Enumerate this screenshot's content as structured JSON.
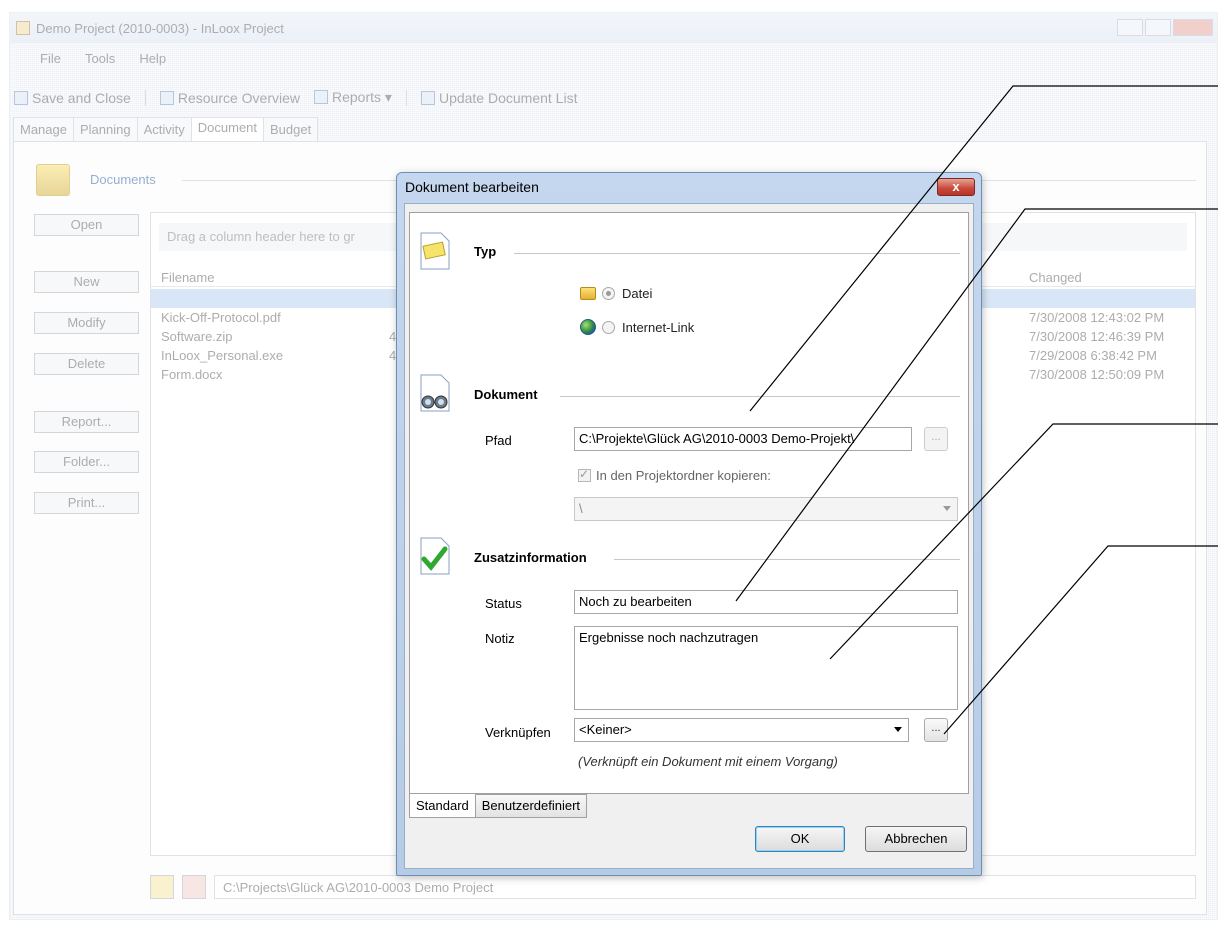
{
  "main_window": {
    "title": "Demo Project (2010-0003) - InLoox Project",
    "menu": [
      "File",
      "Tools",
      "Help"
    ],
    "toolbar": {
      "save_close": "Save and Close",
      "resource_overview": "Resource Overview",
      "reports": "Reports",
      "update_list": "Update Document List"
    },
    "tabs": [
      "Manage",
      "Planning",
      "Activity",
      "Document",
      "Budget"
    ],
    "active_tab": "Document",
    "documents_title": "Documents",
    "side_buttons": [
      "Open",
      "New",
      "Modify",
      "Delete",
      "Report...",
      "Folder...",
      "Print..."
    ],
    "grid": {
      "group_hint": "Drag a column header here to gr",
      "columns": [
        "Filename",
        "Changed"
      ],
      "rows": [
        {
          "filename": "",
          "size": "",
          "changed": ""
        },
        {
          "filename": "Kick-Off-Protocol.pdf",
          "size": "",
          "changed": "7/30/2008 12:43:02 PM"
        },
        {
          "filename": "Software.zip",
          "size": "4",
          "changed": "7/30/2008 12:46:39 PM"
        },
        {
          "filename": "InLoox_Personal.exe",
          "size": "4",
          "changed": "7/29/2008 6:38:42 PM"
        },
        {
          "filename": "Form.docx",
          "size": "",
          "changed": "7/30/2008 12:50:09 PM"
        }
      ]
    },
    "footer_path": "C:\\Projects\\Glück AG\\2010-0003 Demo Project"
  },
  "dialog": {
    "title": "Dokument bearbeiten",
    "close_glyph": "x",
    "typ": {
      "heading": "Typ",
      "options": [
        {
          "label": "Datei",
          "checked": true,
          "icon": "folder-icon"
        },
        {
          "label": "Internet-Link",
          "checked": false,
          "icon": "globe-icon"
        }
      ]
    },
    "dokument": {
      "heading": "Dokument",
      "path_label": "Pfad",
      "path_value": "C:\\Projekte\\Glück AG\\2010-0003 Demo-Projekt\\",
      "browse_label": "...",
      "copy_label": "In den Projektordner kopieren:",
      "copy_checked": true,
      "folder_value": "\\"
    },
    "zusatz": {
      "heading": "Zusatzinformation",
      "status_label": "Status",
      "status_value": "Noch zu bearbeiten",
      "note_label": "Notiz",
      "note_value": "Ergebnisse noch nachzutragen",
      "link_label": "Verknüpfen",
      "link_value": "<Keiner>",
      "link_browse": "...",
      "link_hint": "(Verknüpft ein Dokument mit einem Vorgang)"
    },
    "tabs": [
      "Standard",
      "Benutzerdefiniert"
    ],
    "ok_label": "OK",
    "cancel_label": "Abbrechen"
  }
}
